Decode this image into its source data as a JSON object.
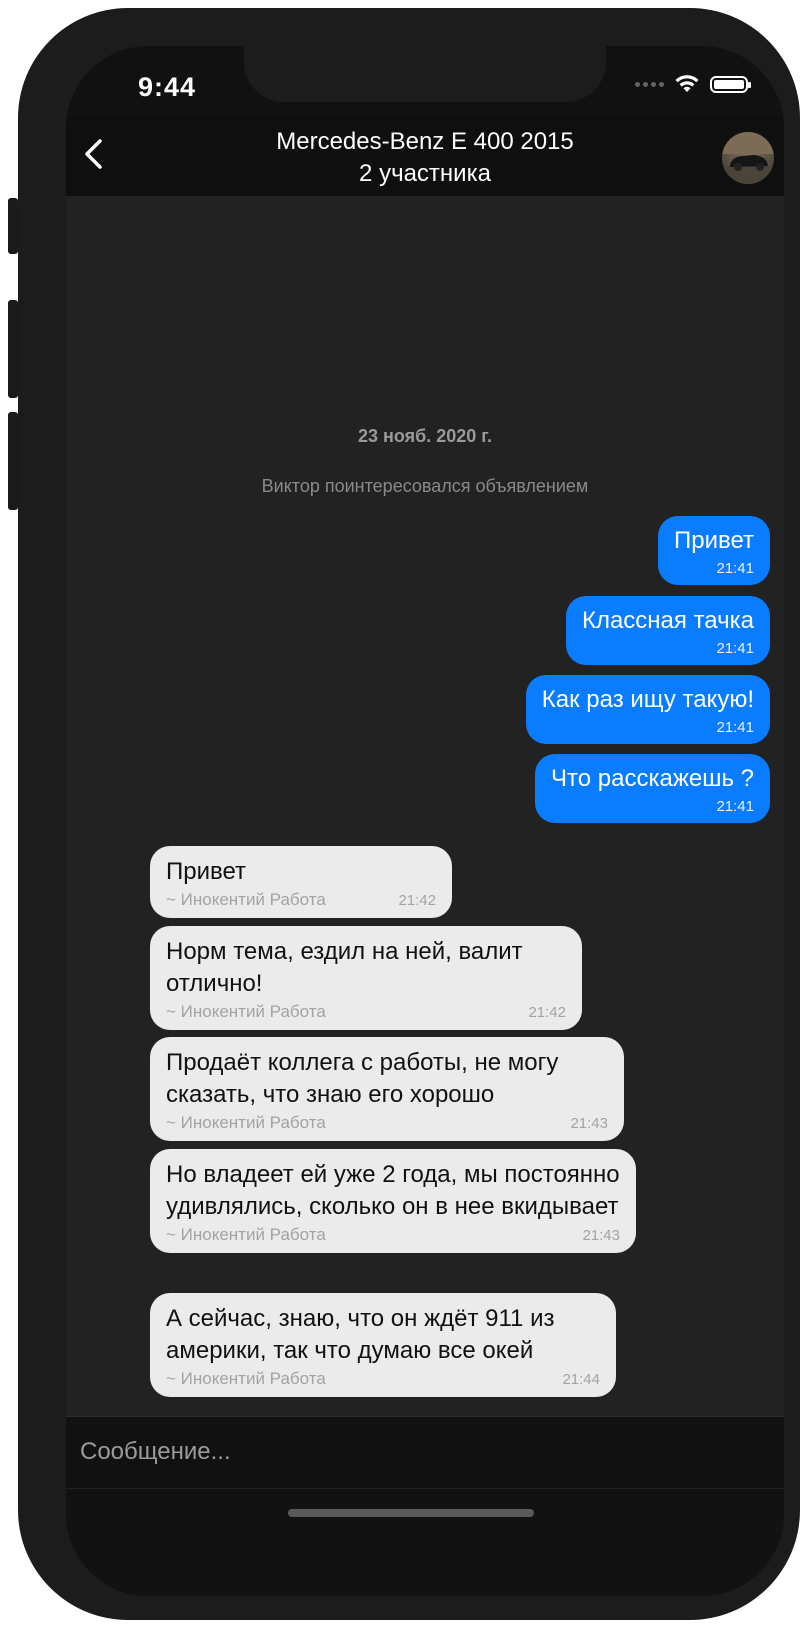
{
  "status_bar": {
    "time": "9:44",
    "icons": [
      "signal-dots-icon",
      "wifi-icon",
      "battery-icon"
    ]
  },
  "header": {
    "title": "Mercedes-Benz E 400 2015",
    "subtitle": "2 участника",
    "back_icon": "chevron-left-icon",
    "avatar": "car-avatar"
  },
  "chat": {
    "date": "23 нояб. 2020 г.",
    "system_message": "Виктор поинтересовался объявлением",
    "outgoing": [
      {
        "text": "Привет",
        "time": "21:41"
      },
      {
        "text": "Классная тачка",
        "time": "21:41"
      },
      {
        "text": "Как раз ищу такую!",
        "time": "21:41"
      },
      {
        "text": "Что расскажешь ?",
        "time": "21:41"
      }
    ],
    "incoming": [
      {
        "text": "Привет",
        "sender": "~ Инокентий Работа",
        "time": "21:42"
      },
      {
        "text": "Норм тема, ездил на ней, валит отлично!",
        "sender": "~ Инокентий Работа",
        "time": "21:42"
      },
      {
        "text": "Продаёт коллега с работы, не могу сказать, что знаю его хорошо",
        "sender": "~ Инокентий Работа",
        "time": "21:43"
      },
      {
        "text": "Но владеет ей уже 2 года, мы постоянно удивлялись, сколько он в нее вкидывает",
        "sender": "~ Инокентий Работа",
        "time": "21:43"
      },
      {
        "text": "А сейчас, знаю, что он ждёт 911 из америки, так что думаю все окей",
        "sender": "~ Инокентий Работа",
        "time": "21:44"
      }
    ]
  },
  "composer": {
    "placeholder": "Сообщение..."
  },
  "colors": {
    "outgoing_bubble": "#0a7cff",
    "incoming_bubble": "#ebebeb",
    "chat_background": "#222223"
  }
}
